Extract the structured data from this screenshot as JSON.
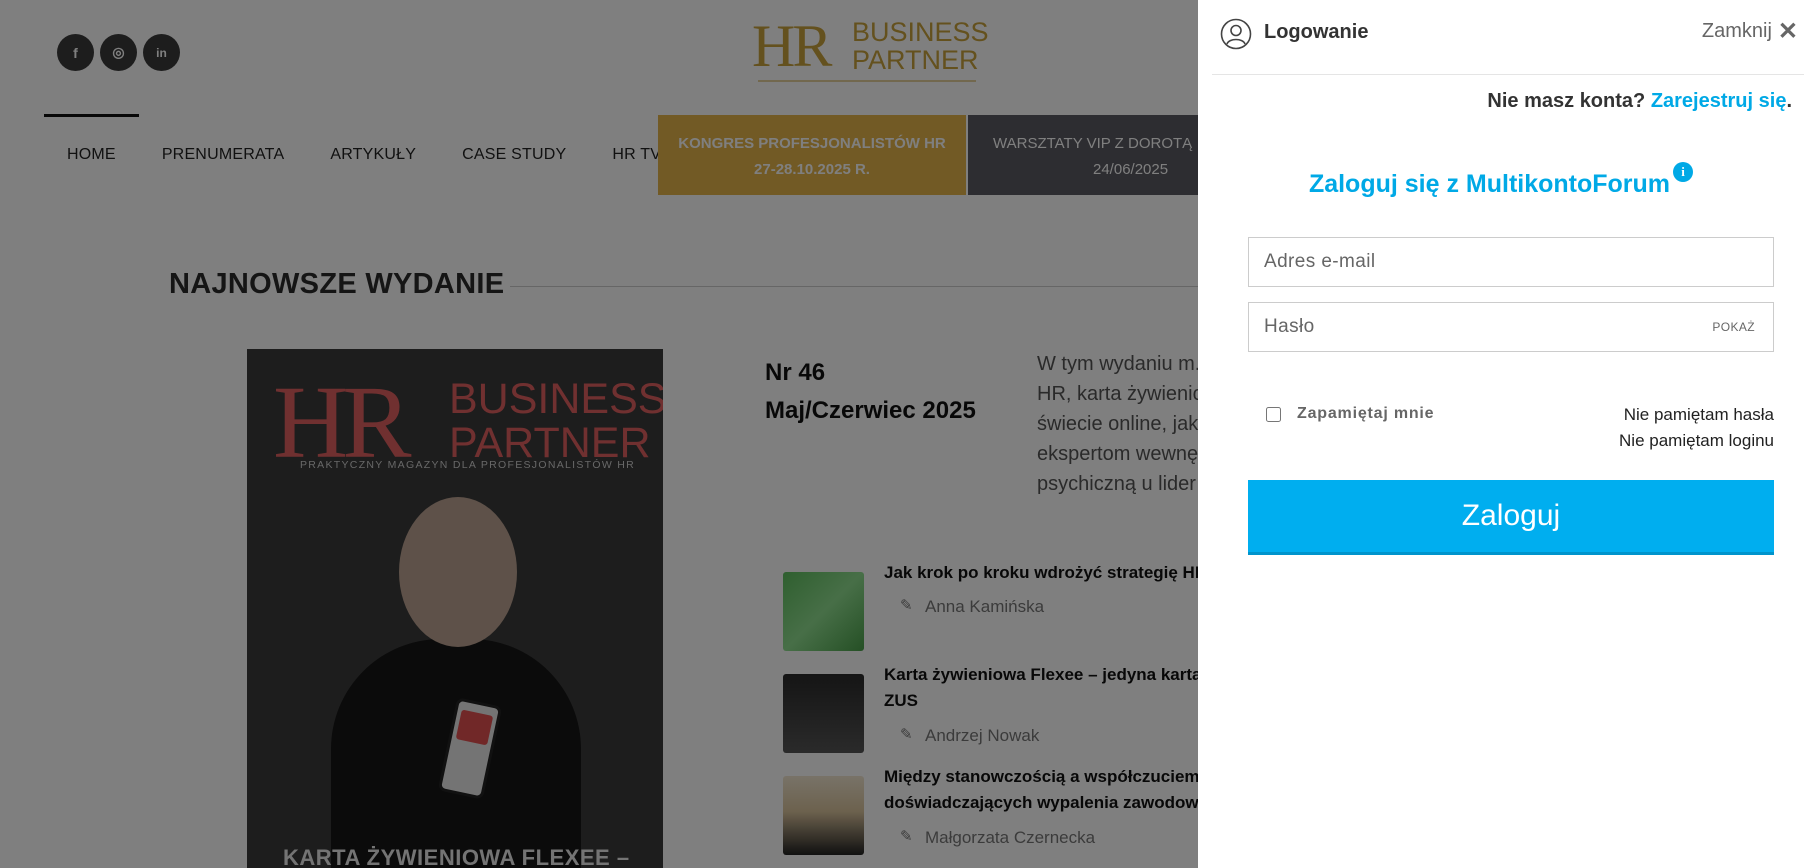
{
  "site": {
    "logo": {
      "hr": "HR",
      "bp_line1": "BUSINESS",
      "bp_line2": "PARTNER"
    },
    "social": [
      "f",
      "◎",
      "in"
    ],
    "nav": {
      "items": [
        "HOME",
        "PRENUMERATA",
        "ARTYKUŁY",
        "CASE STUDY",
        "HR TV"
      ],
      "kongres": {
        "line1": "KONGRES PROFESJONALISTÓW HR",
        "line2": "27-28.10.2025 R."
      },
      "warsztaty": {
        "line1": "WARSZTATY VIP Z DOROTĄ",
        "line2": "24/06/2025"
      }
    },
    "section_title": "NAJNOWSZE WYDANIE",
    "cover": {
      "hr": "HR",
      "bp_line1": "BUSINESS",
      "bp_line2": "PARTNER",
      "tagline": "PRAKTYCZNY MAGAZYN DLA PROFESJONALISTÓW HR",
      "headline": "KARTA ŻYWIENIOWA FLEXEE –"
    },
    "issue": {
      "nr": "Nr 46",
      "date": "Maj/Czerwiec 2025"
    },
    "issue_desc": [
      "W tym wydaniu m...",
      "HR, karta żywienic",
      "świecie online, jak",
      "ekspertom wewnę",
      "psychiczną u lider"
    ],
    "articles": [
      {
        "title": "Jak krok po kroku wdrożyć strategię HR",
        "title2": "",
        "author": "Anna Kamińska"
      },
      {
        "title": "Karta żywieniowa Flexee – jedyna karta",
        "title2": "ZUS",
        "author": "Andrzej Nowak"
      },
      {
        "title": "Między stanowczością a współczuciem.",
        "title2": "doświadczających wypalenia zawodowe",
        "author": "Małgorzata Czernecka"
      }
    ]
  },
  "login": {
    "title": "Logowanie",
    "close_label": "Zamknij",
    "register_question": "Nie masz konta?",
    "register_link": "Zarejestruj się",
    "register_dot": ".",
    "multikonto_title": "Zaloguj się z MultikontoForum",
    "info_glyph": "i",
    "email_placeholder": "Adres e-mail",
    "password_placeholder": "Hasło",
    "show_label": "POKAŻ",
    "remember_label": "Zapamiętaj mnie",
    "forgot_password": "Nie pamiętam hasła",
    "forgot_login": "Nie pamiętam loginu",
    "submit_label": "Zaloguj"
  },
  "colors": {
    "accent": "#00aeef",
    "kongres": "#e5b54b",
    "warsztaty": "#5a5a62",
    "gold": "#c9a23c"
  }
}
